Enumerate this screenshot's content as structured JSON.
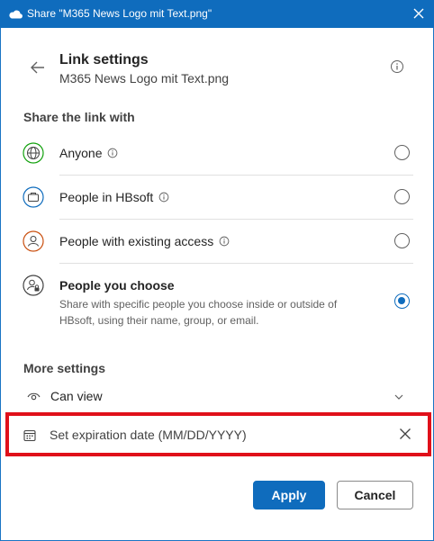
{
  "titlebar": {
    "title": "Share \"M365 News Logo mit Text.png\"",
    "icon": "onedrive-cloud-icon",
    "close_icon": "close-icon"
  },
  "header": {
    "back_icon": "back-arrow-icon",
    "heading": "Link settings",
    "filename": "M365 News Logo mit Text.png",
    "info_icon": "info-icon"
  },
  "share": {
    "label": "Share the link with",
    "options": [
      {
        "label": "Anyone",
        "icon": "globe-icon",
        "has_info": true,
        "selected": false
      },
      {
        "label": "People in HBsoft",
        "icon": "briefcase-icon",
        "has_info": true,
        "selected": false
      },
      {
        "label": "People with existing access",
        "icon": "person-icon",
        "has_info": true,
        "selected": false
      },
      {
        "label": "People you choose",
        "description": "Share with specific people you choose inside or outside of HBsoft, using their name, group, or email.",
        "icon": "person-lock-icon",
        "has_info": false,
        "selected": true
      }
    ]
  },
  "more": {
    "label": "More settings",
    "permission": {
      "label": "Can view",
      "icon": "eye-icon",
      "dropdown_icon": "chevron-down-icon"
    },
    "expiration": {
      "placeholder": "Set expiration date (MM/DD/YYYY)",
      "icon": "calendar-icon",
      "clear_icon": "clear-icon",
      "highlight_color": "#e0101a"
    }
  },
  "actions": {
    "apply": "Apply",
    "cancel": "Cancel"
  },
  "colors": {
    "accent": "#0f6cbd",
    "globe": "#13a10e",
    "briefcase": "#0f6cbd",
    "person": "#ca5010"
  }
}
